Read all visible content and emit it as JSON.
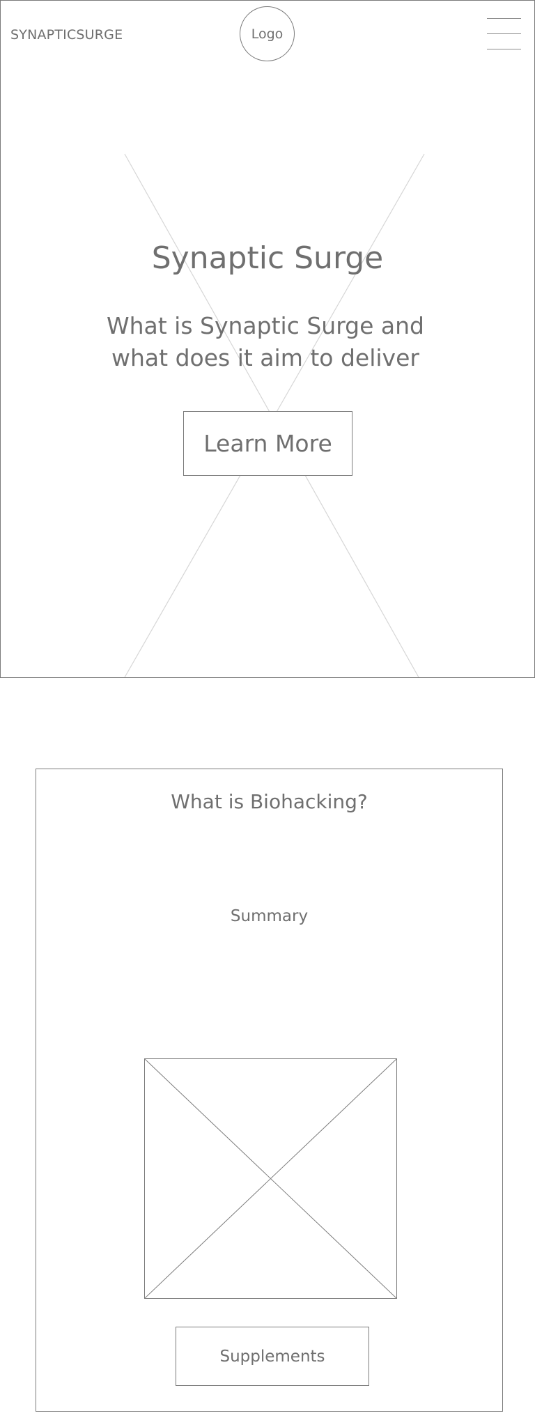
{
  "header": {
    "brand": "SYNAPTICSURGE",
    "logo_text": "Logo",
    "menu_icon": "hamburger-menu-icon"
  },
  "hero": {
    "title": "Synaptic Surge",
    "subtitle": "What is Synaptic Surge and what does it aim to deliver",
    "button_label": "Learn More",
    "background": "image-placeholder"
  },
  "biohacking": {
    "title": "What is Biohacking?",
    "summary": "Summary",
    "image": "image-placeholder",
    "button_label": "Supplements"
  },
  "colors": {
    "text": "#6f6f6f",
    "border": "#7a7a7a",
    "placeholder_lines": "#d6d6d6",
    "background": "#ffffff"
  }
}
